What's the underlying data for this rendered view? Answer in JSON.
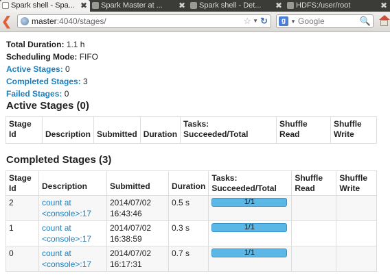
{
  "browser": {
    "tabs": [
      {
        "label": "Spark shell - Spa...",
        "active": true
      },
      {
        "label": "Spark Master at ...",
        "active": false
      },
      {
        "label": "Spark shell - Det...",
        "active": false
      },
      {
        "label": "HDFS:/user/root",
        "active": false
      }
    ],
    "url_host": "master",
    "url_rest": ":4040/stages/",
    "search_engine": "Google",
    "search_placeholder": "Google",
    "icons": [
      "back-arrow-icon",
      "globe-icon",
      "star-icon",
      "dropdown-icon",
      "reload-icon",
      "google-icon",
      "search-icon",
      "home-icon",
      "close-icon"
    ]
  },
  "summary": {
    "total_duration_label": "Total Duration:",
    "total_duration_value": "1.1 h",
    "scheduling_mode_label": "Scheduling Mode:",
    "scheduling_mode_value": "FIFO",
    "active_stages_label": "Active Stages:",
    "active_stages_value": "0",
    "completed_stages_label": "Completed Stages:",
    "completed_stages_value": "3",
    "failed_stages_label": "Failed Stages:",
    "failed_stages_value": "0"
  },
  "active_section": {
    "heading": "Active Stages (0)",
    "headers": {
      "stage_id": [
        "Stage",
        "Id"
      ],
      "description": "Description",
      "submitted": "Submitted",
      "duration": "Duration",
      "tasks": [
        "Tasks:",
        "Succeeded/Total"
      ],
      "shuffle_read": [
        "Shuffle",
        "Read"
      ],
      "shuffle_write": [
        "Shuffle",
        "Write"
      ]
    }
  },
  "completed_section": {
    "heading": "Completed Stages (3)",
    "headers": {
      "stage_id": [
        "Stage",
        "Id"
      ],
      "description": "Description",
      "submitted": "Submitted",
      "duration": "Duration",
      "tasks": [
        "Tasks:",
        "Succeeded/Total"
      ],
      "shuffle_read": [
        "Shuffle",
        "Read"
      ],
      "shuffle_write": [
        "Shuffle",
        "Write"
      ]
    },
    "rows": [
      {
        "id": "2",
        "desc1": "count at",
        "desc2": "<console>:17",
        "date": "2014/07/02",
        "time": "16:43:46",
        "duration": "0.5 s",
        "tasks": "1/1",
        "tasks_fraction": 1.0,
        "shuffle_read": "",
        "shuffle_write": ""
      },
      {
        "id": "1",
        "desc1": "count at",
        "desc2": "<console>:17",
        "date": "2014/07/02",
        "time": "16:38:59",
        "duration": "0.3 s",
        "tasks": "1/1",
        "tasks_fraction": 1.0,
        "shuffle_read": "",
        "shuffle_write": ""
      },
      {
        "id": "0",
        "desc1": "count at",
        "desc2": "<console>:17",
        "date": "2014/07/02",
        "time": "16:17:31",
        "duration": "0.7 s",
        "tasks": "1/1",
        "tasks_fraction": 1.0,
        "shuffle_read": "",
        "shuffle_write": ""
      }
    ]
  },
  "colors": {
    "link": "#1b7fbd",
    "progress_bar": "#3ea3dc",
    "tab_strip": "#3b3b38"
  }
}
